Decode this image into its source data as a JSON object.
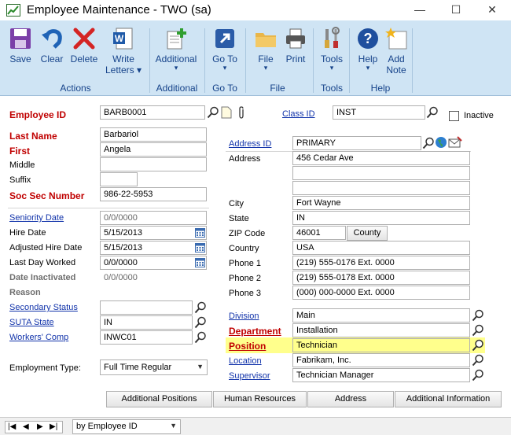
{
  "window": {
    "title": "Employee Maintenance  -  TWO (sa)",
    "minimize": "—",
    "maximize": "☐",
    "close": "✕"
  },
  "ribbon": {
    "buttons": {
      "save": "Save",
      "clear": "Clear",
      "delete": "Delete",
      "write_letters": "Write Letters",
      "additional": "Additional",
      "go_to": "Go To",
      "file": "File",
      "print": "Print",
      "tools": "Tools",
      "help": "Help",
      "add_note_1": "Add",
      "add_note_2": "Note"
    },
    "groups": {
      "actions": "Actions",
      "additional": "Additional",
      "go_to": "Go To",
      "file": "File",
      "tools": "Tools",
      "help": "Help"
    }
  },
  "form": {
    "employee_id": {
      "label": "Employee ID",
      "value": "BARB0001"
    },
    "class_id": {
      "label": "Class ID",
      "value": "INST"
    },
    "inactive": {
      "label": "Inactive",
      "checked": false
    },
    "last_name": {
      "label": "Last Name",
      "value": "Barbariol"
    },
    "first": {
      "label": "First",
      "value": "Angela"
    },
    "middle": {
      "label": "Middle",
      "value": ""
    },
    "suffix": {
      "label": "Suffix",
      "value": ""
    },
    "ssn": {
      "label": "Soc Sec Number",
      "value": "986-22-5953"
    },
    "seniority_date": {
      "label": "Seniority Date",
      "value": "0/0/0000"
    },
    "hire_date": {
      "label": "Hire Date",
      "value": "5/15/2013"
    },
    "adjusted_hire_date": {
      "label": "Adjusted Hire Date",
      "value": "5/15/2013"
    },
    "last_day_worked": {
      "label": "Last Day Worked",
      "value": "0/0/0000"
    },
    "date_inactivated": {
      "label": "Date Inactivated",
      "value": "0/0/0000"
    },
    "reason": {
      "label": "Reason",
      "value": ""
    },
    "secondary_status": {
      "label": "Secondary Status",
      "value": ""
    },
    "suta_state": {
      "label": "SUTA State",
      "value": "IN"
    },
    "workers_comp": {
      "label": "Workers' Comp",
      "value": "INWC01"
    },
    "employment_type": {
      "label": "Employment Type:",
      "value": "Full Time Regular"
    },
    "address_id": {
      "label": "Address ID",
      "value": "PRIMARY"
    },
    "address": {
      "label": "Address",
      "line1": "456 Cedar Ave",
      "line2": "",
      "line3": ""
    },
    "city": {
      "label": "City",
      "value": "Fort Wayne"
    },
    "state": {
      "label": "State",
      "value": "IN"
    },
    "zip": {
      "label": "ZIP Code",
      "value": "46001"
    },
    "county_button": "County",
    "country": {
      "label": "Country",
      "value": "USA"
    },
    "phone1": {
      "label": "Phone 1",
      "value": "(219) 555-0176  Ext. 0000"
    },
    "phone2": {
      "label": "Phone 2",
      "value": "(219) 555-0178  Ext. 0000"
    },
    "phone3": {
      "label": "Phone 3",
      "value": "(000) 000-0000  Ext. 0000"
    },
    "division": {
      "label": "Division",
      "value": "Main"
    },
    "department": {
      "label": "Department",
      "value": "Installation"
    },
    "position": {
      "label": "Position",
      "value": "Technician"
    },
    "location": {
      "label": "Location",
      "value": "Fabrikam, Inc."
    },
    "supervisor": {
      "label": "Supervisor",
      "value": "Technician Manager"
    }
  },
  "tabs": {
    "additional_positions": "Additional Positions",
    "human_resources": "Human Resources",
    "address": "Address",
    "additional_information": "Additional Information"
  },
  "navigation": {
    "sort_by": "by Employee ID"
  },
  "colors": {
    "ribbon_bg": "#cfe4f4",
    "required": "#c00000",
    "link": "#1133aa",
    "highlight": "#ffff8c"
  }
}
